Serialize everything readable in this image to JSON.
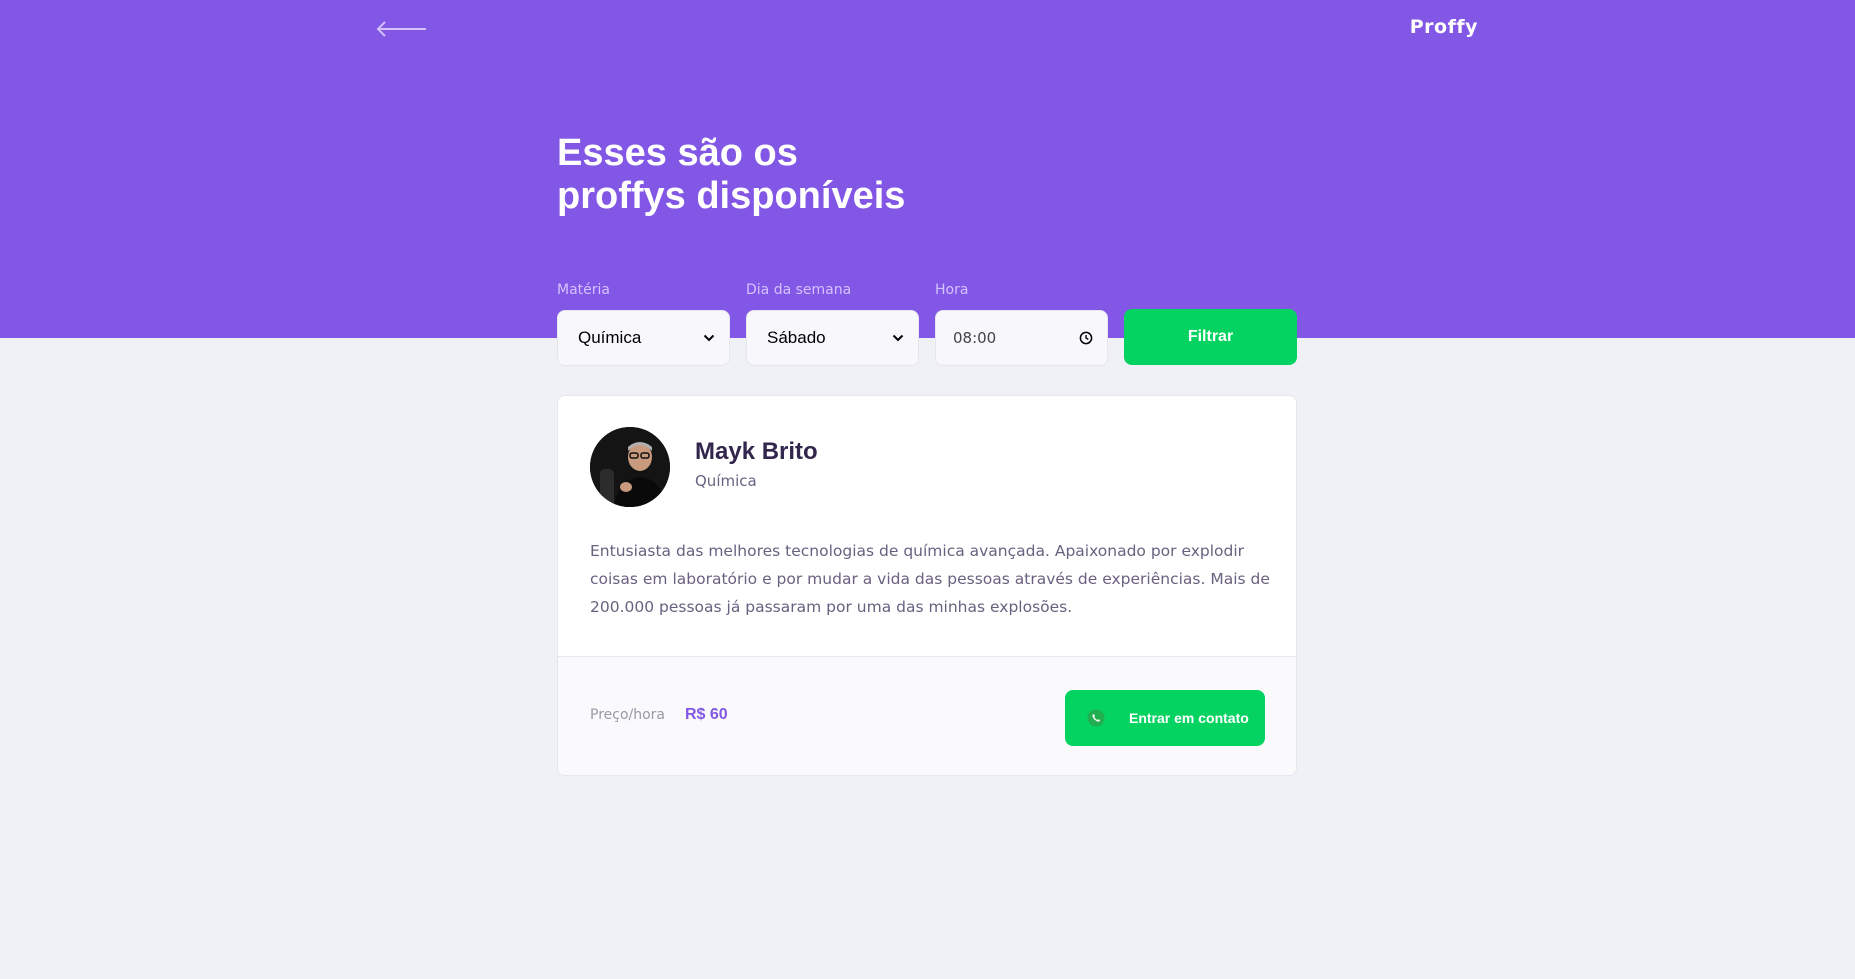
{
  "header": {
    "logo": "Proffy",
    "title_line1": "Esses são os",
    "title_line2": "proffys disponíveis",
    "back_icon": "arrow-left-icon"
  },
  "filters": {
    "subject": {
      "label": "Matéria",
      "value": "Química"
    },
    "weekday": {
      "label": "Dia da semana",
      "value": "Sábado"
    },
    "time": {
      "label": "Hora",
      "value": "08:00"
    },
    "submit_label": "Filtrar"
  },
  "teacher": {
    "name": "Mayk Brito",
    "subject": "Química",
    "bio": "Entusiasta das melhores tecnologias de química avançada. Apaixonado por explodir coisas em laboratório e por mudar a vida das pessoas através de experiências. Mais de 200.000 pessoas já passaram por uma das minhas explosões.",
    "price_label": "Preço/hora",
    "price_value": "R$ 60",
    "contact_label": "Entrar em contato",
    "contact_icon": "whatsapp-icon"
  },
  "colors": {
    "primary": "#8257E5",
    "secondary": "#04D361",
    "background": "#F0F0F7",
    "title_text": "#32264D",
    "body_text": "#6A6180"
  }
}
